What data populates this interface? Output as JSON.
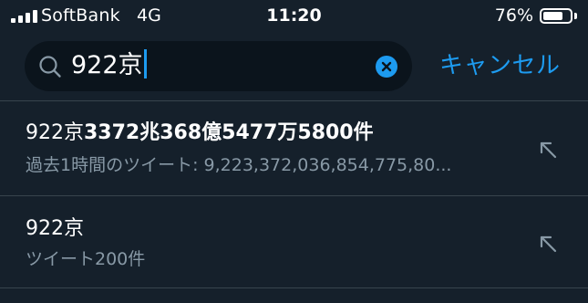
{
  "status_bar": {
    "carrier": "SoftBank",
    "network": "4G",
    "time": "11:20",
    "battery_percent_label": "76%",
    "battery_level": 0.76,
    "signal_bars": 4
  },
  "search": {
    "query": "922京",
    "cancel_label": "キャンセル",
    "icons": {
      "search": "search-icon",
      "clear": "clear-icon"
    }
  },
  "suggestions": [
    {
      "title_prefix": "922京",
      "title_count": "3372兆368億5477万5800件",
      "subtitle": "過去1時間のツイート: 9,223,372,036,854,775,80...",
      "icon": "arrow-up-left-icon"
    },
    {
      "title_prefix": "922京",
      "title_count": "",
      "subtitle": "ツイート200件",
      "icon": "arrow-up-left-icon"
    }
  ],
  "colors": {
    "background": "#15202b",
    "search_field": "#0b141c",
    "accent": "#1d9bf0",
    "secondary_text": "#8899a6",
    "divider": "#38444d"
  }
}
